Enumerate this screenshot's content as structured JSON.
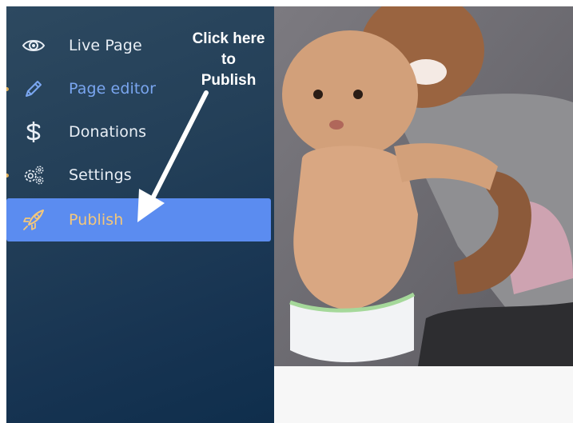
{
  "sidebar": {
    "items": [
      {
        "label": "Live Page",
        "icon": "eye-icon"
      },
      {
        "label": "Page editor",
        "icon": "pencil-icon"
      },
      {
        "label": "Donations",
        "icon": "dollar-icon"
      },
      {
        "label": "Settings",
        "icon": "gears-icon"
      },
      {
        "label": "Publish",
        "icon": "rocket-icon"
      }
    ]
  },
  "annotation": {
    "line1": "Click here",
    "line2": "to",
    "line3": "Publish"
  },
  "colors": {
    "sidebar_top": "#2d4960",
    "sidebar_bottom": "#0f2e4c",
    "active_blue": "#7aa6f0",
    "publish_bg": "#5b8cf0",
    "publish_text": "#f4c77a",
    "indicator_dot": "#e3b25a"
  }
}
